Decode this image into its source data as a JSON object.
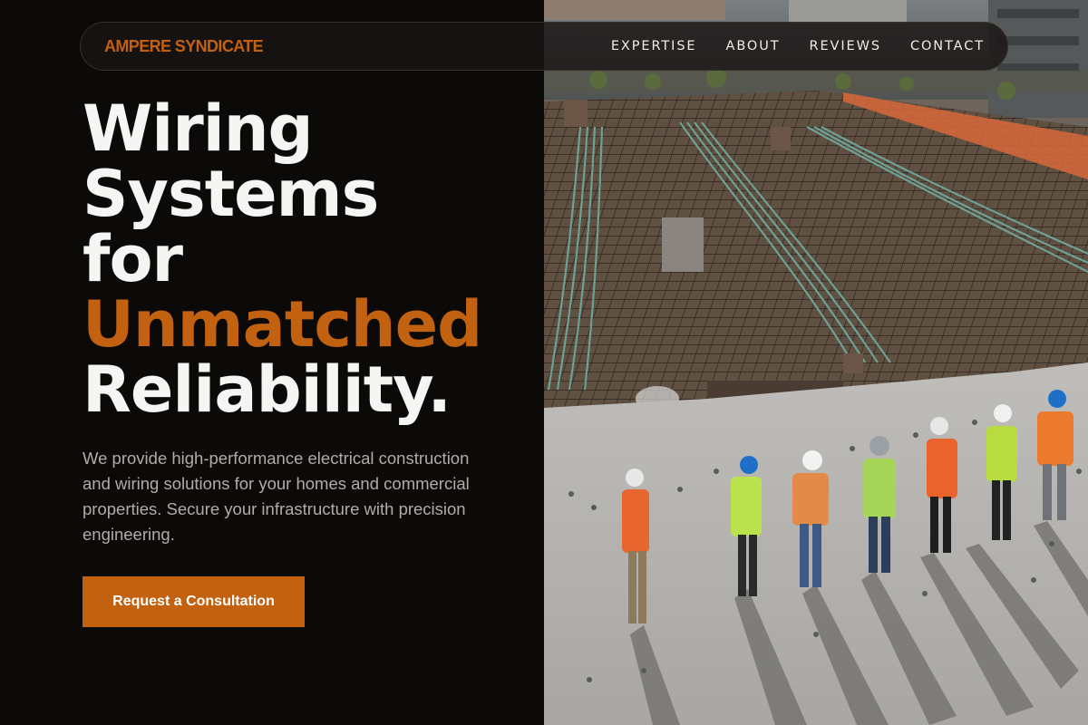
{
  "nav": {
    "brand": "AMPERE SYNDICATE",
    "links": [
      {
        "label": "EXPERTISE"
      },
      {
        "label": "ABOUT"
      },
      {
        "label": "REVIEWS"
      },
      {
        "label": "CONTACT"
      }
    ]
  },
  "hero": {
    "title_lines": [
      "Wiring",
      "Systems",
      "for"
    ],
    "title_accent": "Unmatched",
    "title_end": "Reliability.",
    "description": "We provide high-performance electrical construction and wiring solutions for your homes and commercial properties. Secure your infrastructure with precision engineering.",
    "cta_label": "Request a Consultation"
  },
  "colors": {
    "background": "#0c0a09",
    "accent": "#c2610f",
    "text": "#f5f5f4",
    "muted_text": "#b4aba3"
  }
}
